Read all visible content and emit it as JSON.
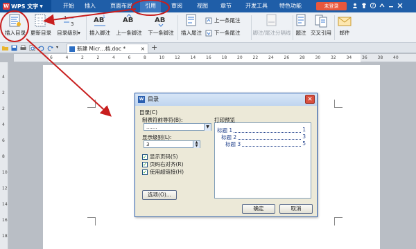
{
  "app": {
    "title": "WPS 文字"
  },
  "menu": [
    "开始",
    "插入",
    "页面布局",
    "引用",
    "审阅",
    "视图",
    "章节",
    "开发工具",
    "特色功能"
  ],
  "menu_active": "引用",
  "login_label": "未登录",
  "ribbon": {
    "insert_toc": "插入目录",
    "update_toc": "更新目录",
    "toc_level": "目录级别",
    "insert_footnote": "插入脚注",
    "prev_footnote": "上一条脚注",
    "next_footnote": "下一条脚注",
    "insert_endnote": "插入尾注",
    "prev_endnote": "上一条尾注",
    "next_endnote": "下一条尾注",
    "footnote_sep": "脚注/尾注分隔线",
    "caption": "题注",
    "cross_ref": "交叉引用",
    "mail": "邮件"
  },
  "tabs": {
    "doc_title": "新建 Micr…档.doc *"
  },
  "ruler_h": [
    "6",
    "4",
    "2",
    "2",
    "4",
    "6",
    "8",
    "10",
    "12",
    "14",
    "16",
    "18",
    "20",
    "22",
    "24",
    "26",
    "28",
    "30",
    "32",
    "34",
    "36",
    "38",
    "40"
  ],
  "ruler_v": [
    "4",
    "2",
    "2",
    "4",
    "6",
    "8",
    "10",
    "12",
    "14",
    "16",
    "18"
  ],
  "dialog": {
    "title": "目录",
    "group_label": "目录(C)",
    "leader_label": "制表符前导符(B):",
    "leader_value": ".......",
    "level_label": "显示级别(L):",
    "level_value": "3",
    "show_page_numbers": "显示页码(S)",
    "right_align_page_numbers": "页码右对齐(R)",
    "use_hyperlinks": "使用超链接(H)",
    "options_button": "选项(O)...",
    "preview_label": "打印预览",
    "preview_rows": [
      {
        "text": "标题 1",
        "page": "1"
      },
      {
        "text": "标题 2",
        "page": "3"
      },
      {
        "text": "标题 3",
        "page": "5"
      }
    ],
    "ok_button": "确定",
    "cancel_button": "取消"
  },
  "colors": {
    "menubar": "#1f5ea8",
    "annotation": "#c81e1e",
    "login": "#e8573c"
  }
}
